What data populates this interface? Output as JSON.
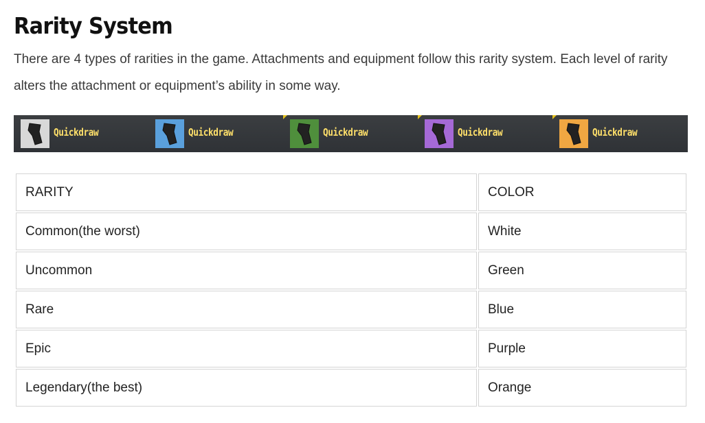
{
  "heading": "Rarity System",
  "intro": "There are 4 types of rarities in the game. Attachments and equipment follow this rarity system. Each level of rarity alters the attachment or equipment’s ability in some way.",
  "banner": {
    "items": [
      {
        "label": "Quickdraw",
        "color": "#d8d8d8",
        "icon": "grip-icon"
      },
      {
        "label": "Quickdraw",
        "color": "#5aa0dc",
        "icon": "grip-icon"
      },
      {
        "label": "Quickdraw",
        "color": "#4f8f3c",
        "icon": "grip-icon"
      },
      {
        "label": "Quickdraw",
        "color": "#a569d6",
        "icon": "grip-icon"
      },
      {
        "label": "Quickdraw",
        "color": "#f0a742",
        "icon": "grip-icon"
      }
    ]
  },
  "table": {
    "header": [
      "RARITY",
      "COLOR"
    ],
    "rows": [
      [
        "Common(the worst)",
        "White"
      ],
      [
        "Uncommon",
        "Green"
      ],
      [
        "Rare",
        "Blue"
      ],
      [
        "Epic",
        "Purple"
      ],
      [
        "Legendary(the best)",
        "Orange"
      ]
    ]
  }
}
